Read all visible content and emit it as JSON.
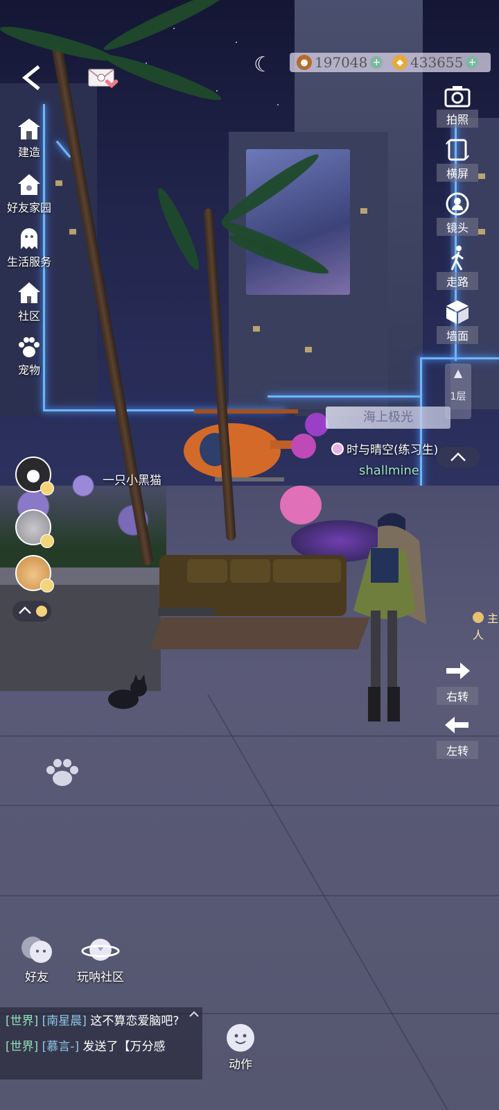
{
  "hud": {
    "currency": [
      {
        "icon": "acorn-icon",
        "value": "197048"
      },
      {
        "icon": "gem-icon",
        "value": "433655"
      }
    ]
  },
  "left_menu": [
    {
      "id": "build",
      "icon": "house-icon",
      "label": "建造"
    },
    {
      "id": "friend-home",
      "icon": "friend-house-icon",
      "label": "好友家园"
    },
    {
      "id": "life-service",
      "icon": "ghost-service-icon",
      "label": "生活服务"
    },
    {
      "id": "community",
      "icon": "community-house-icon",
      "label": "社区"
    },
    {
      "id": "pet",
      "icon": "paw-icon",
      "label": "宠物"
    }
  ],
  "right_tools": [
    {
      "id": "photo",
      "icon": "camera-icon",
      "label": "拍照"
    },
    {
      "id": "landscape",
      "icon": "rotate-screen-icon",
      "label": "横屏"
    },
    {
      "id": "lens",
      "icon": "lens-icon",
      "label": "镜头"
    },
    {
      "id": "walk",
      "icon": "walk-icon",
      "label": "走路"
    },
    {
      "id": "wall",
      "icon": "cube-icon",
      "label": "墙面"
    }
  ],
  "floor": {
    "label": "1层"
  },
  "scene": {
    "banner": "海上极光",
    "npc_name": "时与晴空(练习生)",
    "player_name": "shallmine",
    "cat_label": "一只小黑猫",
    "owner_label": "主人"
  },
  "turns": [
    {
      "id": "turn-right",
      "glyph": "➜",
      "label": "右转"
    },
    {
      "id": "turn-left",
      "glyph": "←",
      "label": "左转"
    }
  ],
  "bottom": {
    "friends": "好友",
    "community": "玩呐社区",
    "actions": "动作"
  },
  "chat": [
    {
      "channel": "[世界]",
      "name": "[南星晨]",
      "text": "这不算恋爱脑吧?"
    },
    {
      "channel": "[世界]",
      "name": "[慕言-]",
      "text": "发送了【万分感"
    }
  ]
}
